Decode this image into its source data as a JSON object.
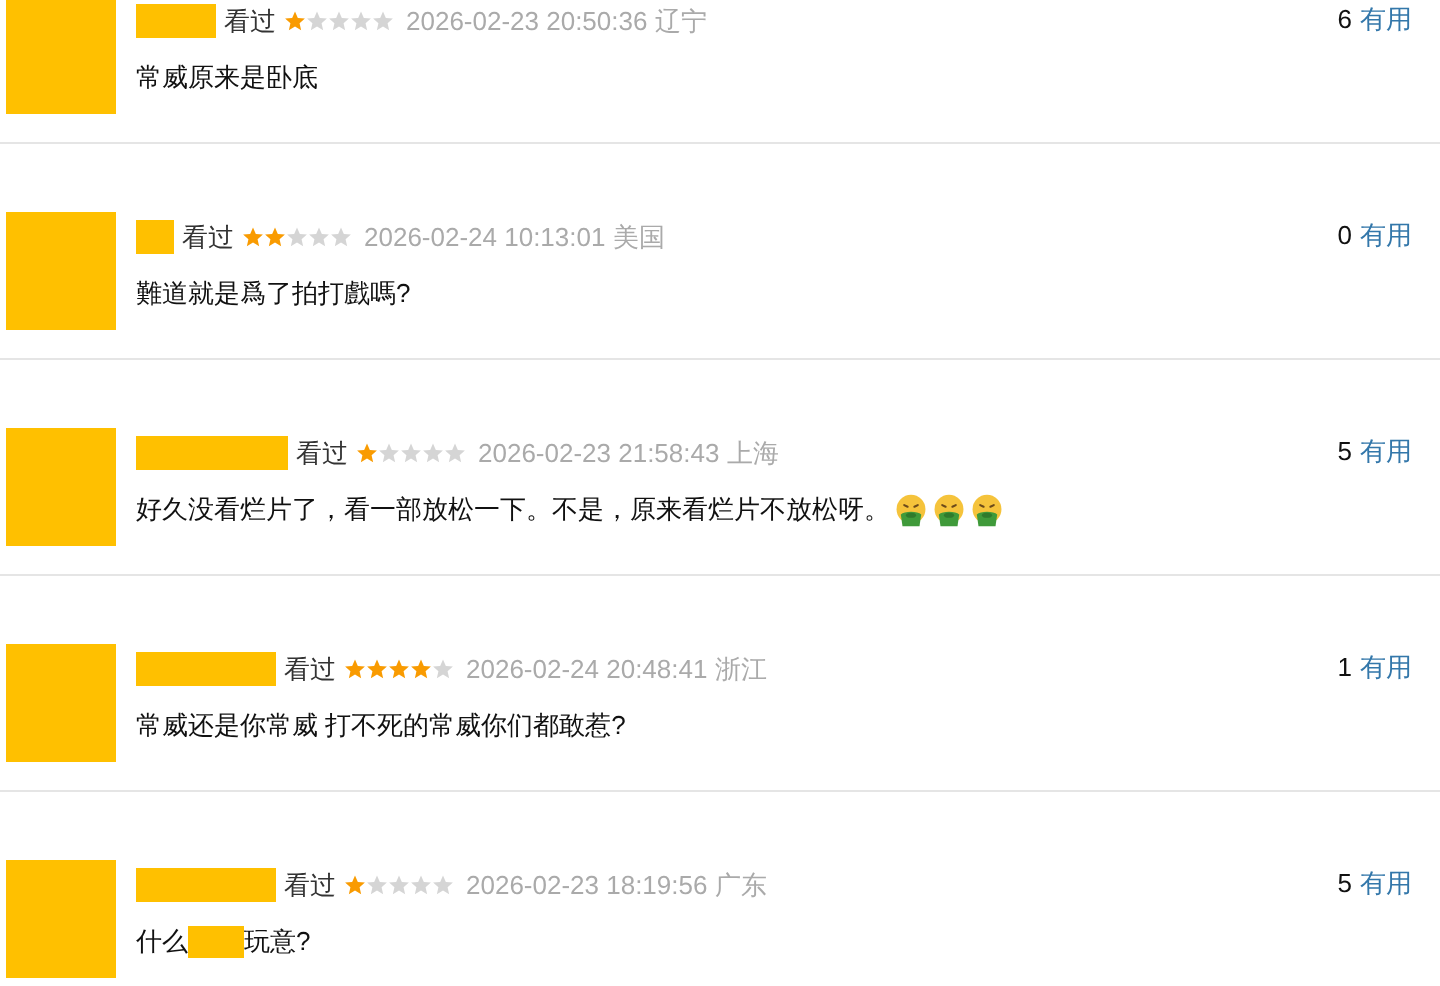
{
  "comments": [
    {
      "status": "看过",
      "stars": 1,
      "time": "2026-02-23 20:50:36",
      "location": "辽宁",
      "text_parts": [
        "常威原来是卧底"
      ],
      "useful_count": "6",
      "useful_label": "有用"
    },
    {
      "status": "看过",
      "stars": 2,
      "time": "2026-02-24 10:13:01",
      "location": "美国",
      "text_parts": [
        "難道就是爲了拍打戲嗎?"
      ],
      "useful_count": "0",
      "useful_label": "有用"
    },
    {
      "status": "看过",
      "stars": 1,
      "time": "2026-02-23 21:58:43",
      "location": "上海",
      "text_parts": [
        "好久没看烂片了，看一部放松一下。不是，原来看烂片不放松呀。"
      ],
      "trailing_icons": [
        {
          "kind": "vomit"
        },
        {
          "kind": "vomit"
        },
        {
          "kind": "vomit"
        }
      ],
      "useful_count": "5",
      "useful_label": "有用"
    },
    {
      "status": "看过",
      "stars": 4,
      "time": "2026-02-24 20:48:41",
      "location": "浙江",
      "text_parts": [
        "常威还是你常威 打不死的常威你们都敢惹?"
      ],
      "useful_count": "1",
      "useful_label": "有用"
    },
    {
      "status": "看过",
      "stars": 1,
      "time": "2026-02-23 18:19:56",
      "location": "广东",
      "text_parts": [
        "什么",
        "玩意?"
      ],
      "useful_count": "5",
      "useful_label": "有用"
    }
  ]
}
